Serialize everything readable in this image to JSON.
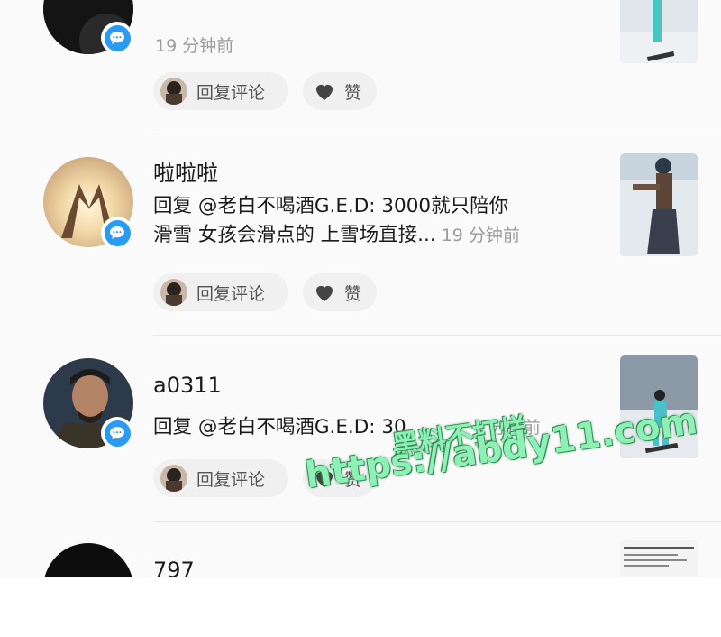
{
  "comments": [
    {
      "username": "",
      "text": "",
      "time": "19 分钟前",
      "reply_label": "回复评论",
      "like_label": "赞"
    },
    {
      "username": "啦啦啦",
      "text_line1": "回复 @老白不喝酒G.E.D: 3000就只陪你",
      "text_line2": "滑雪 女孩会滑点的 上雪场直接...",
      "time": "19 分钟前",
      "reply_label": "回复评论",
      "like_label": "赞"
    },
    {
      "username": "a0311",
      "text_line1": "回复 @老白不喝酒G.E.D: 30",
      "time": "分钟前",
      "reply_label": "回复评论",
      "like_label": "赞"
    },
    {
      "username": "797"
    }
  ],
  "watermark": {
    "line1": "黑料不打烊",
    "line2": "https://abdy11.com"
  },
  "colors": {
    "accent": "#2a9af2",
    "watermark": "#8ef0b4"
  }
}
